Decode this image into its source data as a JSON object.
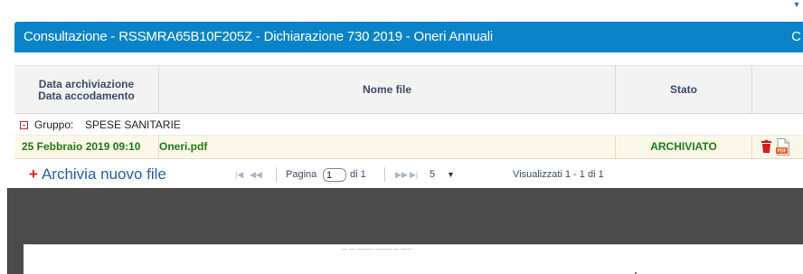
{
  "panel": {
    "title": "Consultazione - RSSMRA65B10F205Z - Dichiarazione 730 2019 - Oneri Annuali",
    "edge_char": "C",
    "accent_color": "#0a83c8"
  },
  "table": {
    "headers": {
      "date_line1": "Data archiviazione",
      "date_line2": "Data accodamento",
      "filename": "Nome file",
      "status": "Stato"
    },
    "group": {
      "toggle": "-",
      "label": "Gruppo:",
      "value": "SPESE SANITARIE"
    },
    "rows": [
      {
        "date": "25 Febbraio 2019 09:10",
        "filename": "Oneri.pdf",
        "status": "ARCHIVIATO",
        "actions": [
          "trash-icon",
          "pdf-icon"
        ]
      }
    ],
    "status_color": "#1f7a16"
  },
  "pager": {
    "add_plus": "+",
    "add_label": "Archivia nuovo file",
    "first_glyph": "|◀",
    "prev_glyph": "◀◀",
    "next_glyph": "▶▶",
    "last_glyph": "▶|",
    "page_label": "Pagina",
    "page_value": "1",
    "of_label": "di 1",
    "page_size": "5",
    "page_size_arrow": "▼",
    "info": "Visualizzati 1 - 1 di 1"
  },
  "viewer": {
    "heading": "— — ——— ——— — ——"
  }
}
